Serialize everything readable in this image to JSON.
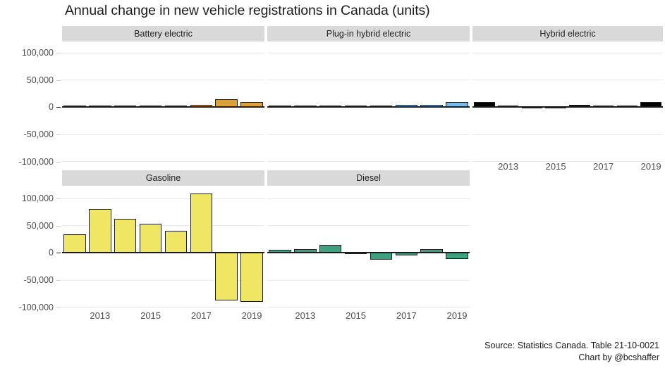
{
  "title": "Annual change in new vehicle registrations in Canada (units)",
  "footer": {
    "source": "Source: Statistics Canada. Table 21-10-0021",
    "credit": "Chart by @bcshaffer"
  },
  "axis": {
    "y_ticks": [
      "100,000",
      "50,000",
      "0",
      "-50,000",
      "-100,000"
    ],
    "x_ticks": [
      "2013",
      "2015",
      "2017",
      "2019"
    ]
  },
  "panels": [
    {
      "label": "Battery electric"
    },
    {
      "label": "Plug-in hybrid electric"
    },
    {
      "label": "Hybrid electric"
    },
    {
      "label": "Gasoline"
    },
    {
      "label": "Diesel"
    }
  ],
  "chart_data": {
    "type": "bar",
    "title": "Annual change in new vehicle registrations in Canada (units)",
    "xlabel": "",
    "ylabel": "",
    "ylim": [
      -115000,
      115000
    ],
    "y_ticks": [
      100000,
      50000,
      0,
      -50000,
      -100000
    ],
    "grid": true,
    "legend": "none",
    "facet": "vehicle fuel type",
    "x": [
      2012,
      2013,
      2014,
      2015,
      2016,
      2017,
      2018,
      2019
    ],
    "x_tick_labels": [
      2013,
      2015,
      2017,
      2019
    ],
    "series": [
      {
        "name": "Battery electric",
        "color": "#d9a13a",
        "values": [
          300,
          500,
          900,
          1200,
          1800,
          4500,
          14000,
          9500
        ]
      },
      {
        "name": "Plug-in hybrid electric",
        "color": "#7db9e3",
        "values": [
          200,
          400,
          700,
          900,
          1100,
          4200,
          4200,
          9000
        ]
      },
      {
        "name": "Hybrid electric",
        "color": "#000000",
        "values": [
          8500,
          500,
          -1500,
          -2500,
          3500,
          900,
          2200,
          8500
        ]
      },
      {
        "name": "Gasoline",
        "color": "#efe764",
        "values": [
          34000,
          80000,
          62000,
          53000,
          40000,
          108000,
          -88000,
          -91000
        ]
      },
      {
        "name": "Diesel",
        "color": "#3da181",
        "values": [
          5000,
          6000,
          14500,
          -2000,
          -13000,
          -5500,
          6000,
          -11000
        ]
      }
    ]
  }
}
